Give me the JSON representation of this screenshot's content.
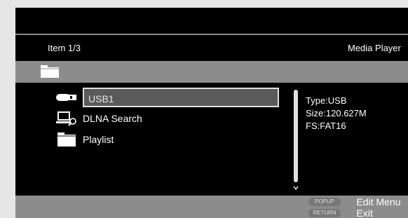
{
  "header": {
    "item_count": "Item 1/3",
    "mode_title": "Media Player"
  },
  "list": [
    {
      "label": "USB1",
      "icon": "usb-drive-icon",
      "selected": true
    },
    {
      "label": "DLNA Search",
      "icon": "network-search-icon",
      "selected": false
    },
    {
      "label": "Playlist",
      "icon": "folder-icon",
      "selected": false
    }
  ],
  "info": {
    "type": "Type:USB",
    "size": "Size:120.627M",
    "fs": "FS:FAT16"
  },
  "footer": {
    "hints": [
      {
        "button": "POPUP",
        "action": "Edit Menu"
      },
      {
        "button": "RETURN",
        "action": "Exit"
      }
    ]
  },
  "colors": {
    "background": "#000000",
    "bar": "#8c8c8c",
    "selection": "#5a5a5a",
    "text": "#ffffff"
  }
}
